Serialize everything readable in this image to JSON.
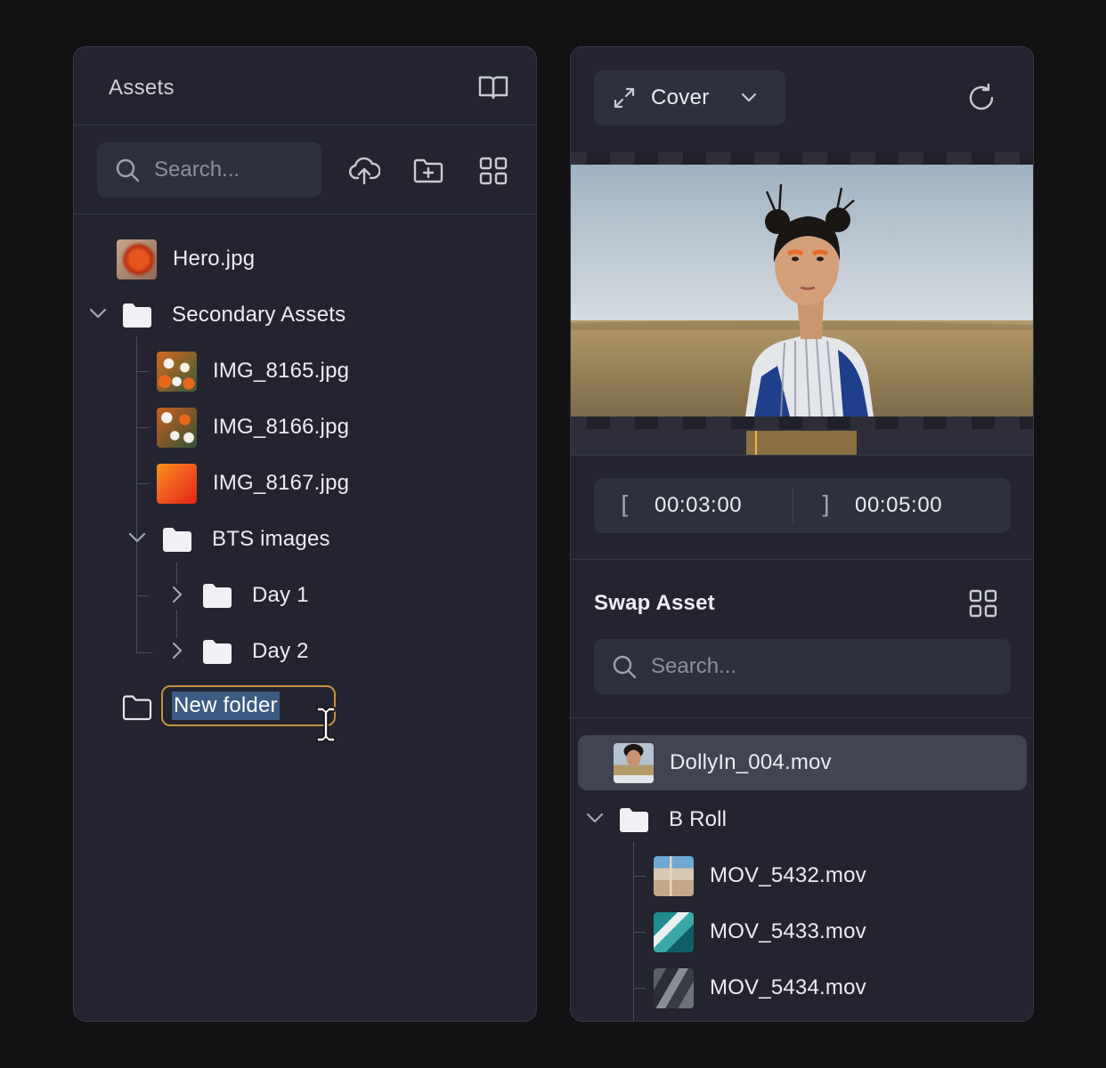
{
  "assets_panel": {
    "title": "Assets",
    "search_placeholder": "Search...",
    "tree": {
      "hero": "Hero.jpg",
      "secondary_folder": "Secondary Assets",
      "img_8165": "IMG_8165.jpg",
      "img_8166": "IMG_8166.jpg",
      "img_8167": "IMG_8167.jpg",
      "bts_folder": "BTS images",
      "day1": "Day 1",
      "day2": "Day 2",
      "new_folder": "New folder"
    }
  },
  "preview_panel": {
    "fit_mode": "Cover",
    "in_time": "00:03:00",
    "out_time": "00:05:00",
    "in_bracket": "[",
    "out_bracket": "]"
  },
  "swap_panel": {
    "title": "Swap Asset",
    "search_placeholder": "Search...",
    "items": {
      "dolly": "DollyIn_004.mov",
      "broll_folder": "B Roll",
      "mov_5432": "MOV_5432.mov",
      "mov_5433": "MOV_5433.mov",
      "mov_5434": "MOV_5434.mov"
    }
  },
  "colors": {
    "background": "#121214",
    "panel": "#23242f",
    "accent_rename": "#c7923d",
    "selection": "#3b5b82",
    "timeline_range": "#8a7044"
  },
  "icons": [
    "book-open-icon",
    "search-icon",
    "upload-cloud-icon",
    "folder-plus-icon",
    "grid-icon",
    "folder-icon",
    "chevron-down-icon",
    "chevron-right-icon",
    "expand-icon",
    "refresh-icon",
    "text-cursor-icon"
  ]
}
